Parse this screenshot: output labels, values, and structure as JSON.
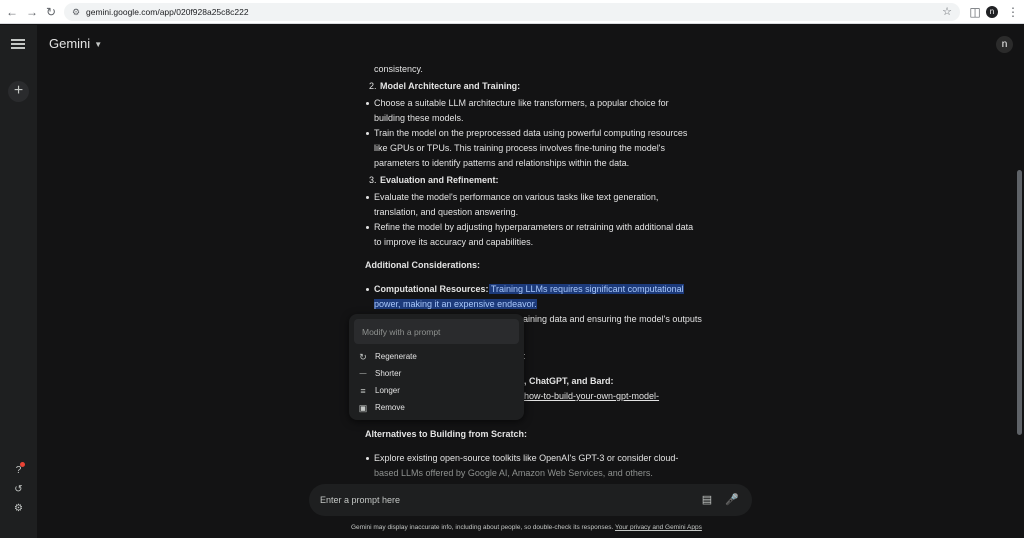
{
  "browser": {
    "url": "gemini.google.com/app/020f928a25c8c222",
    "icons": {
      "back": "back-arrow-icon",
      "forward": "forward-arrow-icon",
      "reload": "reload-icon",
      "site_settings": "site-settings-icon",
      "bookmark": "star-icon",
      "sidepanel": "side-panel-icon",
      "profile": "profile-icon",
      "menu": "kebab-menu-icon"
    }
  },
  "header": {
    "brand": "Gemini"
  },
  "response": {
    "lines": {
      "l0": "consistency.",
      "n2": "2.",
      "h2": "Model Architecture and Training:",
      "b1a": "Choose a suitable LLM architecture like transformers, a popular choice for",
      "b1b": "building these models.",
      "b2a": "Train the model on the preprocessed data using powerful computing resources",
      "b2b": "like GPUs or TPUs. This training process involves fine-tuning the model's",
      "b2c": "parameters to identify patterns and relationships within the data.",
      "n3": "3.",
      "h3": "Evaluation and Refinement:",
      "b3a": "Evaluate the model's performance on various tasks like text generation,",
      "b3b": "translation, and question answering.",
      "b4a": "Refine the model by adjusting hyperparameters or retraining with additional data",
      "b4b": "to improve its accuracy and capabilities.",
      "h4": "Additional Considerations:",
      "b5_bold": "Computational Resources:",
      "b5_hl1": " Training LLMs requires significant computational",
      "b5_hl2": "power, making it an expensive endeavor.",
      "b6_partial": "aining data and ensuring the model's outputs",
      "b7_partial": ":",
      "b8_partial": "T-4, ChatGPT, and Bard:",
      "b8_link": "how-to-build-your-own-gpt-model-",
      "h5": "Alternatives to Building from Scratch:",
      "b9a": "Explore existing open-source toolkits like OpenAI's GPT-3 or consider cloud-",
      "b9b": "based LLMs offered by Google AI, Amazon Web Services, and others."
    }
  },
  "popup": {
    "placeholder": "Modify with a prompt",
    "items": [
      {
        "label": "Regenerate",
        "icon": "regenerate-icon"
      },
      {
        "label": "Shorter",
        "icon": "shorter-icon"
      },
      {
        "label": "Longer",
        "icon": "longer-icon"
      },
      {
        "label": "Remove",
        "icon": "remove-icon"
      }
    ]
  },
  "prompt": {
    "placeholder": "Enter a prompt here"
  },
  "footer": {
    "disclaimer": "Gemini may display inaccurate info, including about people, so double-check its responses.",
    "link": "Your privacy and Gemini Apps"
  },
  "colors": {
    "background": "#131314",
    "sidebar": "#1e1f20",
    "highlight": "#1c3a7a",
    "highlight_text": "#a8c7fa"
  }
}
